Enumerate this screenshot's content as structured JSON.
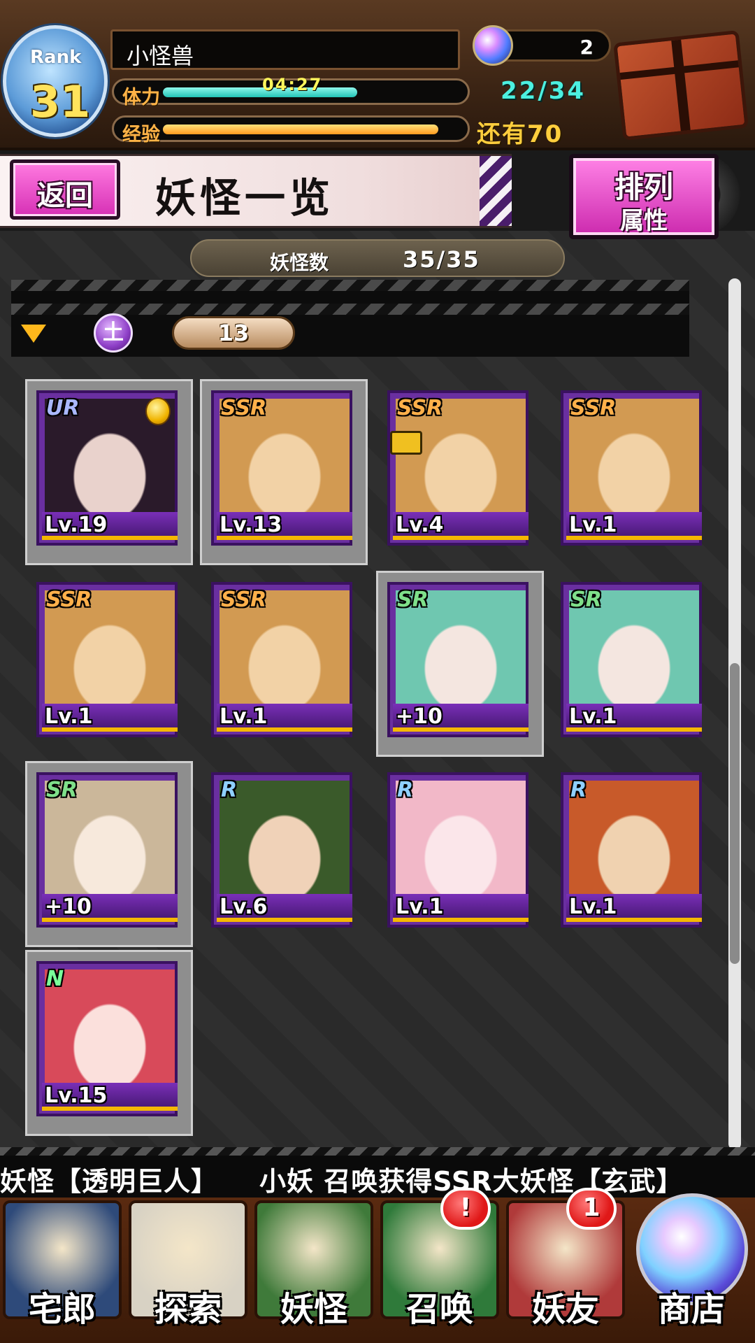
{
  "player": {
    "rank_label": "Rank",
    "rank": "31",
    "name": "小怪兽",
    "gems": "2",
    "stamina_label": "体力",
    "stamina_timer": "04:27",
    "stamina_value": "22/34",
    "stamina_fraction": 0.65,
    "exp_label": "经验",
    "exp_remaining": "还有70",
    "exp_fraction": 0.92
  },
  "header": {
    "back_label": "返回",
    "title": "妖怪一览",
    "sort_title": "排列",
    "sort_mode": "属性"
  },
  "inventory": {
    "count_label": "妖怪数",
    "count_value": "35/35"
  },
  "filter": {
    "attribute_icon": "土",
    "count": "13"
  },
  "cards": [
    {
      "rarity": "UR",
      "level": "Lv.19",
      "selected": true,
      "crown": true,
      "art": [
        "#2a1a2a",
        "#e9d2cc"
      ]
    },
    {
      "rarity": "SSR",
      "level": "Lv.13",
      "selected": true,
      "art": [
        "#d29a52",
        "#f2d2a6"
      ]
    },
    {
      "rarity": "SSR",
      "level": "Lv.4",
      "lock": true,
      "art": [
        "#d29a52",
        "#f2d2a6"
      ]
    },
    {
      "rarity": "SSR",
      "level": "Lv.1",
      "art": [
        "#d29a52",
        "#f2d2a6"
      ]
    },
    {
      "rarity": "SSR",
      "level": "Lv.1",
      "art": [
        "#d29a52",
        "#f2d2a6"
      ]
    },
    {
      "rarity": "SSR",
      "level": "Lv.1",
      "art": [
        "#d29a52",
        "#f2d2a6"
      ]
    },
    {
      "rarity": "SR",
      "level": "+10",
      "selected": true,
      "art": [
        "#6fc7b0",
        "#f4e6e0"
      ]
    },
    {
      "rarity": "SR",
      "level": "Lv.1",
      "art": [
        "#6fc7b0",
        "#f4e6e0"
      ]
    },
    {
      "rarity": "SR",
      "level": "+10",
      "selected": true,
      "art": [
        "#cbb79a",
        "#f7e9dc"
      ]
    },
    {
      "rarity": "R",
      "level": "Lv.6",
      "art": [
        "#3a5a2a",
        "#f0d2b8"
      ]
    },
    {
      "rarity": "R",
      "level": "Lv.1",
      "art": [
        "#f2b8c8",
        "#fbe6ea"
      ]
    },
    {
      "rarity": "R",
      "level": "Lv.1",
      "art": [
        "#c85a2a",
        "#f0d2b0"
      ]
    },
    {
      "rarity": "N",
      "level": "Lv.15",
      "selected": true,
      "art": [
        "#d84a5a",
        "#fbe0dc"
      ]
    }
  ],
  "ticker": {
    "text": "妖怪【透明巨人】　　小妖 召唤获得SSR大妖怪【玄武】"
  },
  "nav": [
    {
      "label": "宅郎",
      "color": "#2e4a7a",
      "icon": "house-icon"
    },
    {
      "label": "探索",
      "color": "#d8d2c4",
      "icon": "magnifier-icon"
    },
    {
      "label": "妖怪",
      "color": "#3f7a3a",
      "icon": "scroll-icon"
    },
    {
      "label": "召唤",
      "color": "#2f7a3a",
      "icon": "pentagram-icon",
      "badge": "!"
    },
    {
      "label": "妖友",
      "color": "#b03a3a",
      "icon": "friend-icon",
      "badge": "1"
    },
    {
      "label": "商店",
      "color": "#2a3a7a",
      "icon": "shop-orb-icon"
    }
  ]
}
